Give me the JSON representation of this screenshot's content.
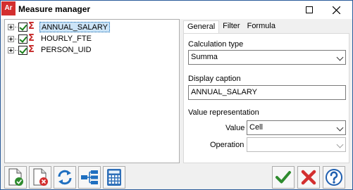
{
  "window": {
    "title": "Measure manager",
    "app_logo": "Ar"
  },
  "tree": {
    "items": [
      {
        "label": "ANNUAL_SALARY",
        "selected": true
      },
      {
        "label": "HOURLY_FTE",
        "selected": false
      },
      {
        "label": "PERSON_UID",
        "selected": false
      }
    ]
  },
  "tabs": [
    {
      "label": "General",
      "active": true
    },
    {
      "label": "Filter",
      "active": false
    },
    {
      "label": "Formula",
      "active": false
    }
  ],
  "general": {
    "calculation_type_label": "Calculation type",
    "calculation_type_value": "Summa",
    "display_caption_label": "Display caption",
    "display_caption_value": "ANNUAL_SALARY",
    "value_representation_label": "Value representation",
    "value_label": "Value",
    "value_value": "Cell",
    "operation_label": "Operation",
    "operation_value": ""
  },
  "toolbar": {
    "left_buttons": [
      "new-measure-icon",
      "delete-measure-icon",
      "refresh-icon",
      "hierarchy-icon",
      "calculator-icon"
    ],
    "right_buttons": [
      "ok-check-icon",
      "cancel-x-icon",
      "help-icon"
    ]
  },
  "colors": {
    "accent": "#2a5b9a",
    "ok": "#2e8b2e",
    "cancel": "#d32f2f",
    "help": "#1f5fb0",
    "selection": "#cce4f7"
  }
}
